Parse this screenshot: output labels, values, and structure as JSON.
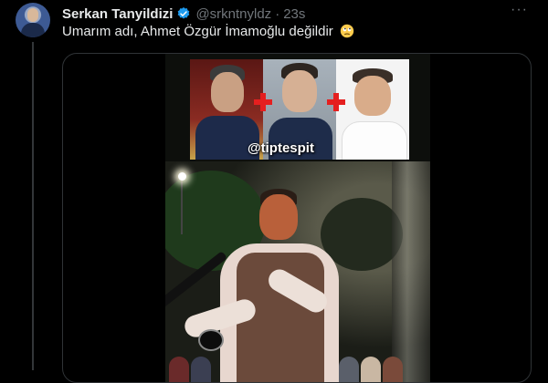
{
  "tweet": {
    "display_name": "Serkan Tanyildizi",
    "handle": "@srkntnyldz",
    "separator": "·",
    "time": "23s",
    "more_label": "···",
    "text": "Umarım adı, Ahmet Özgür İmamoğlu değildir",
    "emoji": "rolling-eyes-emoji",
    "verified_icon": "verified-badge-icon"
  },
  "media": {
    "watermark": "@tiptespit"
  },
  "colors": {
    "background": "#000000",
    "text_primary": "#e7e9ea",
    "text_secondary": "#71767b",
    "verified_blue": "#1d9bf0",
    "border": "#2f3336",
    "plus_red": "#e51f1f"
  }
}
